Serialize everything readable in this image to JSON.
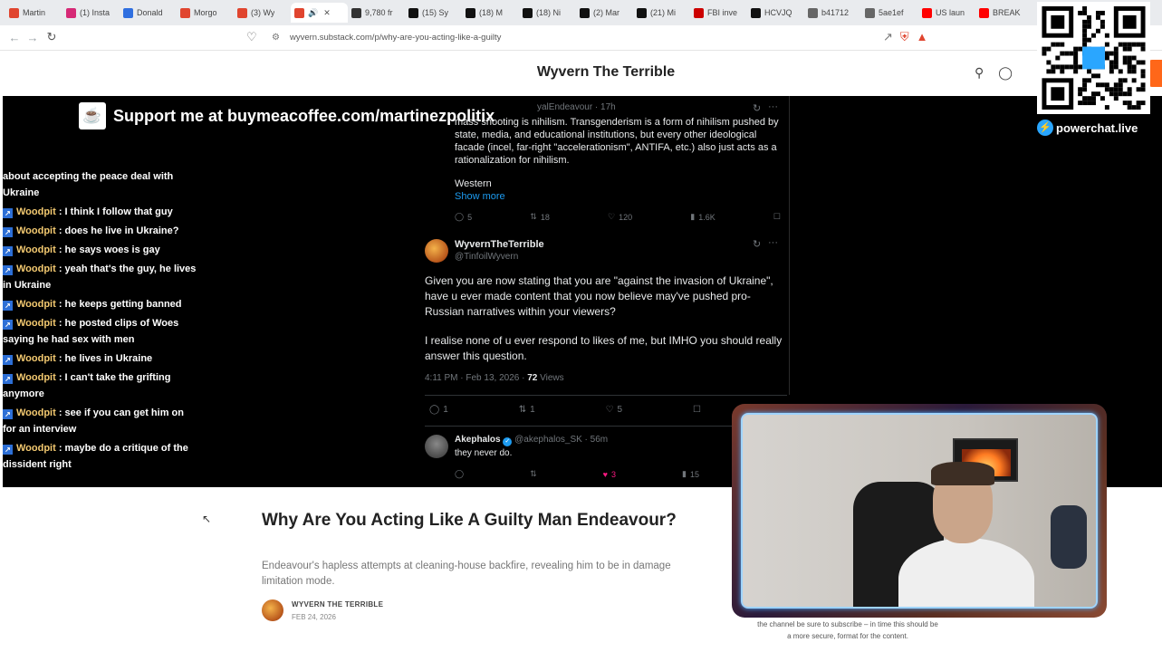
{
  "browser": {
    "tabs": [
      {
        "title": "Martin",
        "color": "#e0452f",
        "icon": "substack-icon"
      },
      {
        "title": "(1) Insta",
        "color": "#d62976",
        "icon": "instagram-icon"
      },
      {
        "title": "Donald",
        "color": "#2f6fe0",
        "icon": "truth-icon"
      },
      {
        "title": "Morgo",
        "color": "#e0452f",
        "icon": "substack-icon"
      },
      {
        "title": "(3) Wy",
        "color": "#e0452f",
        "icon": "substack-icon"
      },
      {
        "title": "🔊",
        "color": "#e0452f",
        "icon": "substack-icon",
        "active": true
      },
      {
        "title": "9,780 fr",
        "color": "#333333",
        "icon": "b-icon"
      },
      {
        "title": "(15) Sy",
        "color": "#111111",
        "icon": "x-icon"
      },
      {
        "title": "(18) M",
        "color": "#111111",
        "icon": "x-icon"
      },
      {
        "title": "(18) Ni",
        "color": "#111111",
        "icon": "x-icon"
      },
      {
        "title": "(2) Mar",
        "color": "#111111",
        "icon": "x-icon"
      },
      {
        "title": "(21) Mi",
        "color": "#111111",
        "icon": "x-icon"
      },
      {
        "title": "FBI inve",
        "color": "#cc0000",
        "icon": "cnn-icon"
      },
      {
        "title": "HCVJQ",
        "color": "#111111",
        "icon": "x-icon"
      },
      {
        "title": "b41712",
        "color": "#666666",
        "icon": "globe-icon"
      },
      {
        "title": "5ae1ef",
        "color": "#666666",
        "icon": "globe-icon"
      },
      {
        "title": "US laun",
        "color": "#ff0000",
        "icon": "youtube-icon"
      },
      {
        "title": "BREAK",
        "color": "#ff0000",
        "icon": "youtube-icon"
      }
    ],
    "url": "wyvern.substack.com/p/why-are-you-acting-like-a-guilty"
  },
  "substack": {
    "site_title": "Wyvern The Terrible"
  },
  "overlay": {
    "support_text": "Support me at buymeacoffee.com/martinezpolitix",
    "powerchat": "powerchat.live"
  },
  "chat": {
    "first_fragment": "about accepting the peace deal with Ukraine",
    "messages": [
      {
        "user": "Woodpit",
        "text": " : I think I follow that guy"
      },
      {
        "user": "Woodpit",
        "text": " : does he live in Ukraine?"
      },
      {
        "user": "Woodpit",
        "text": " : he says woes is gay"
      },
      {
        "user": "Woodpit",
        "text": " : yeah that's the guy, he lives in Ukraine"
      },
      {
        "user": "Woodpit",
        "text": " : he keeps getting banned"
      },
      {
        "user": "Woodpit",
        "text": " : he posted clips of Woes saying he had sex with men"
      },
      {
        "user": "Woodpit",
        "text": " : he lives in Ukraine"
      },
      {
        "user": "Woodpit",
        "text": " : I can't take the grifting anymore"
      },
      {
        "user": "Woodpit",
        "text": " : see if you can get him on for an interview"
      },
      {
        "user": "Woodpit",
        "text": " : maybe do a critique of the dissident right"
      }
    ]
  },
  "tweet1": {
    "user_fragment": "yalEndeavour · 17h",
    "body": "mass shooting is nihilism. Transgenderism is a form of nihilism pushed by state, media, and educational institutions, but every other ideological facade (incel, far-right \"accelerationism\", ANTIFA, etc.) also just acts as a rationalization for nihilism.",
    "western": "Western",
    "show_more": "Show more",
    "replies": "5",
    "reposts": "18",
    "likes": "120",
    "views": "1.6K"
  },
  "tweet2": {
    "name": "WyvernTheTerrible",
    "handle": "@TinfoilWyvern",
    "body1": "Given you are now stating that you are \"against the invasion of Ukraine\", have u ever made content that you now believe may've pushed pro-Russian narratives within your viewers?",
    "body2": "I realise none of u ever respond to likes of me, but IMHO you should really answer this question.",
    "time": "4:11 PM · Feb 13, 2026 · ",
    "views_count": "72",
    "views_label": " Views",
    "replies": "1",
    "reposts": "1",
    "likes": "5"
  },
  "tweet3": {
    "name": "Akephalos",
    "handle": " @akephalos_SK · 56m",
    "body": "they never do.",
    "likes": "3",
    "views": "15"
  },
  "article": {
    "title": "Why Are You Acting Like A Guilty Man Endeavour?",
    "subtitle": "Endeavour's hapless attempts at cleaning-house backfire, revealing him to be in damage limitation mode.",
    "author": "WYVERN THE TERRIBLE",
    "date": "FEB 24, 2026"
  },
  "cam_caption": "the channel be sure to subscribe – in time this should be a more secure, format for the content."
}
